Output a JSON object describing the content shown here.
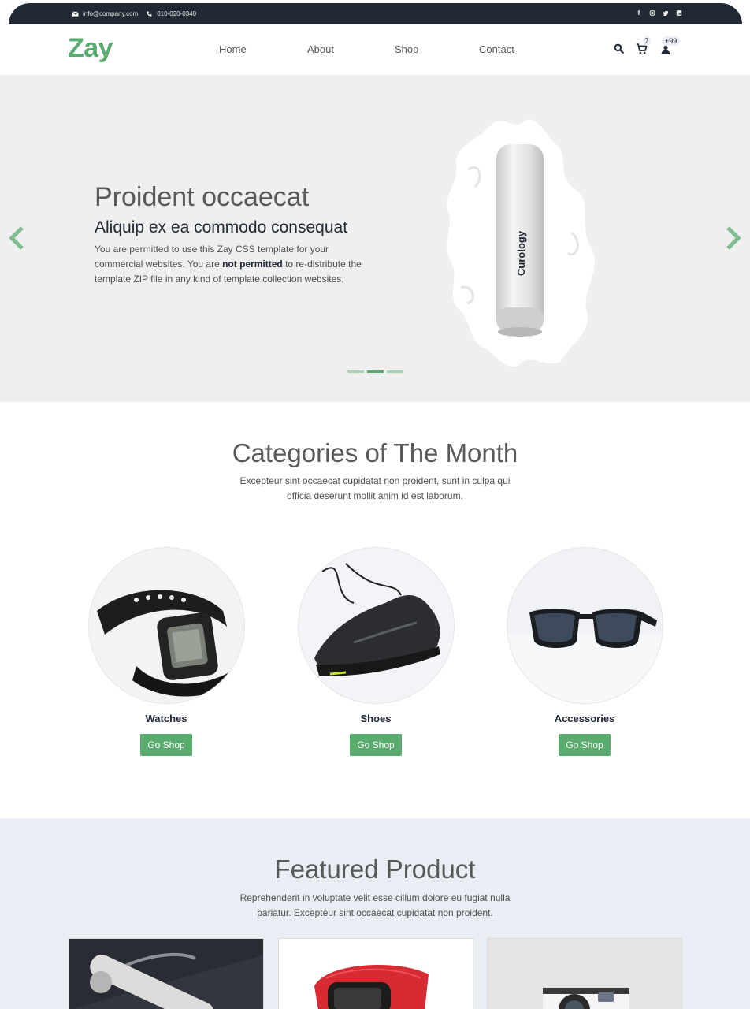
{
  "topbar": {
    "email": "info@company.com",
    "phone": "010-020-0340",
    "social_icons": [
      "facebook-icon",
      "instagram-icon",
      "twitter-icon",
      "linkedin-icon"
    ]
  },
  "header": {
    "logo": "Zay",
    "nav": [
      "Home",
      "About",
      "Shop",
      "Contact"
    ],
    "cart_count": "7",
    "user_count": "+99"
  },
  "hero": {
    "title": "Proident occaecat",
    "subtitle": "Aliquip ex ea commodo consequat",
    "text_1": "You are permitted to use this Zay CSS template for your commercial websites. You are ",
    "text_bold": "not permitted",
    "text_2": " to re-distribute the template ZIP file in any kind of template collection websites.",
    "product_label": "Curology",
    "active_slide": 2,
    "slide_count": 3
  },
  "categories": {
    "title": "Categories of The Month",
    "subtitle": "Excepteur sint occaecat cupidatat non proident, sunt in culpa qui officia deserunt mollit anim id est laborum.",
    "items": [
      {
        "name": "Watches",
        "button": "Go Shop"
      },
      {
        "name": "Shoes",
        "button": "Go Shop"
      },
      {
        "name": "Accessories",
        "button": "Go Shop"
      }
    ]
  },
  "featured": {
    "title": "Featured Product",
    "subtitle": "Reprehenderit in voluptate velit esse cillum dolore eu fugiat nulla pariatur. Excepteur sint occaecat cupidatat non proident."
  },
  "colors": {
    "brand": "#59ab6e",
    "dark": "#212934"
  }
}
